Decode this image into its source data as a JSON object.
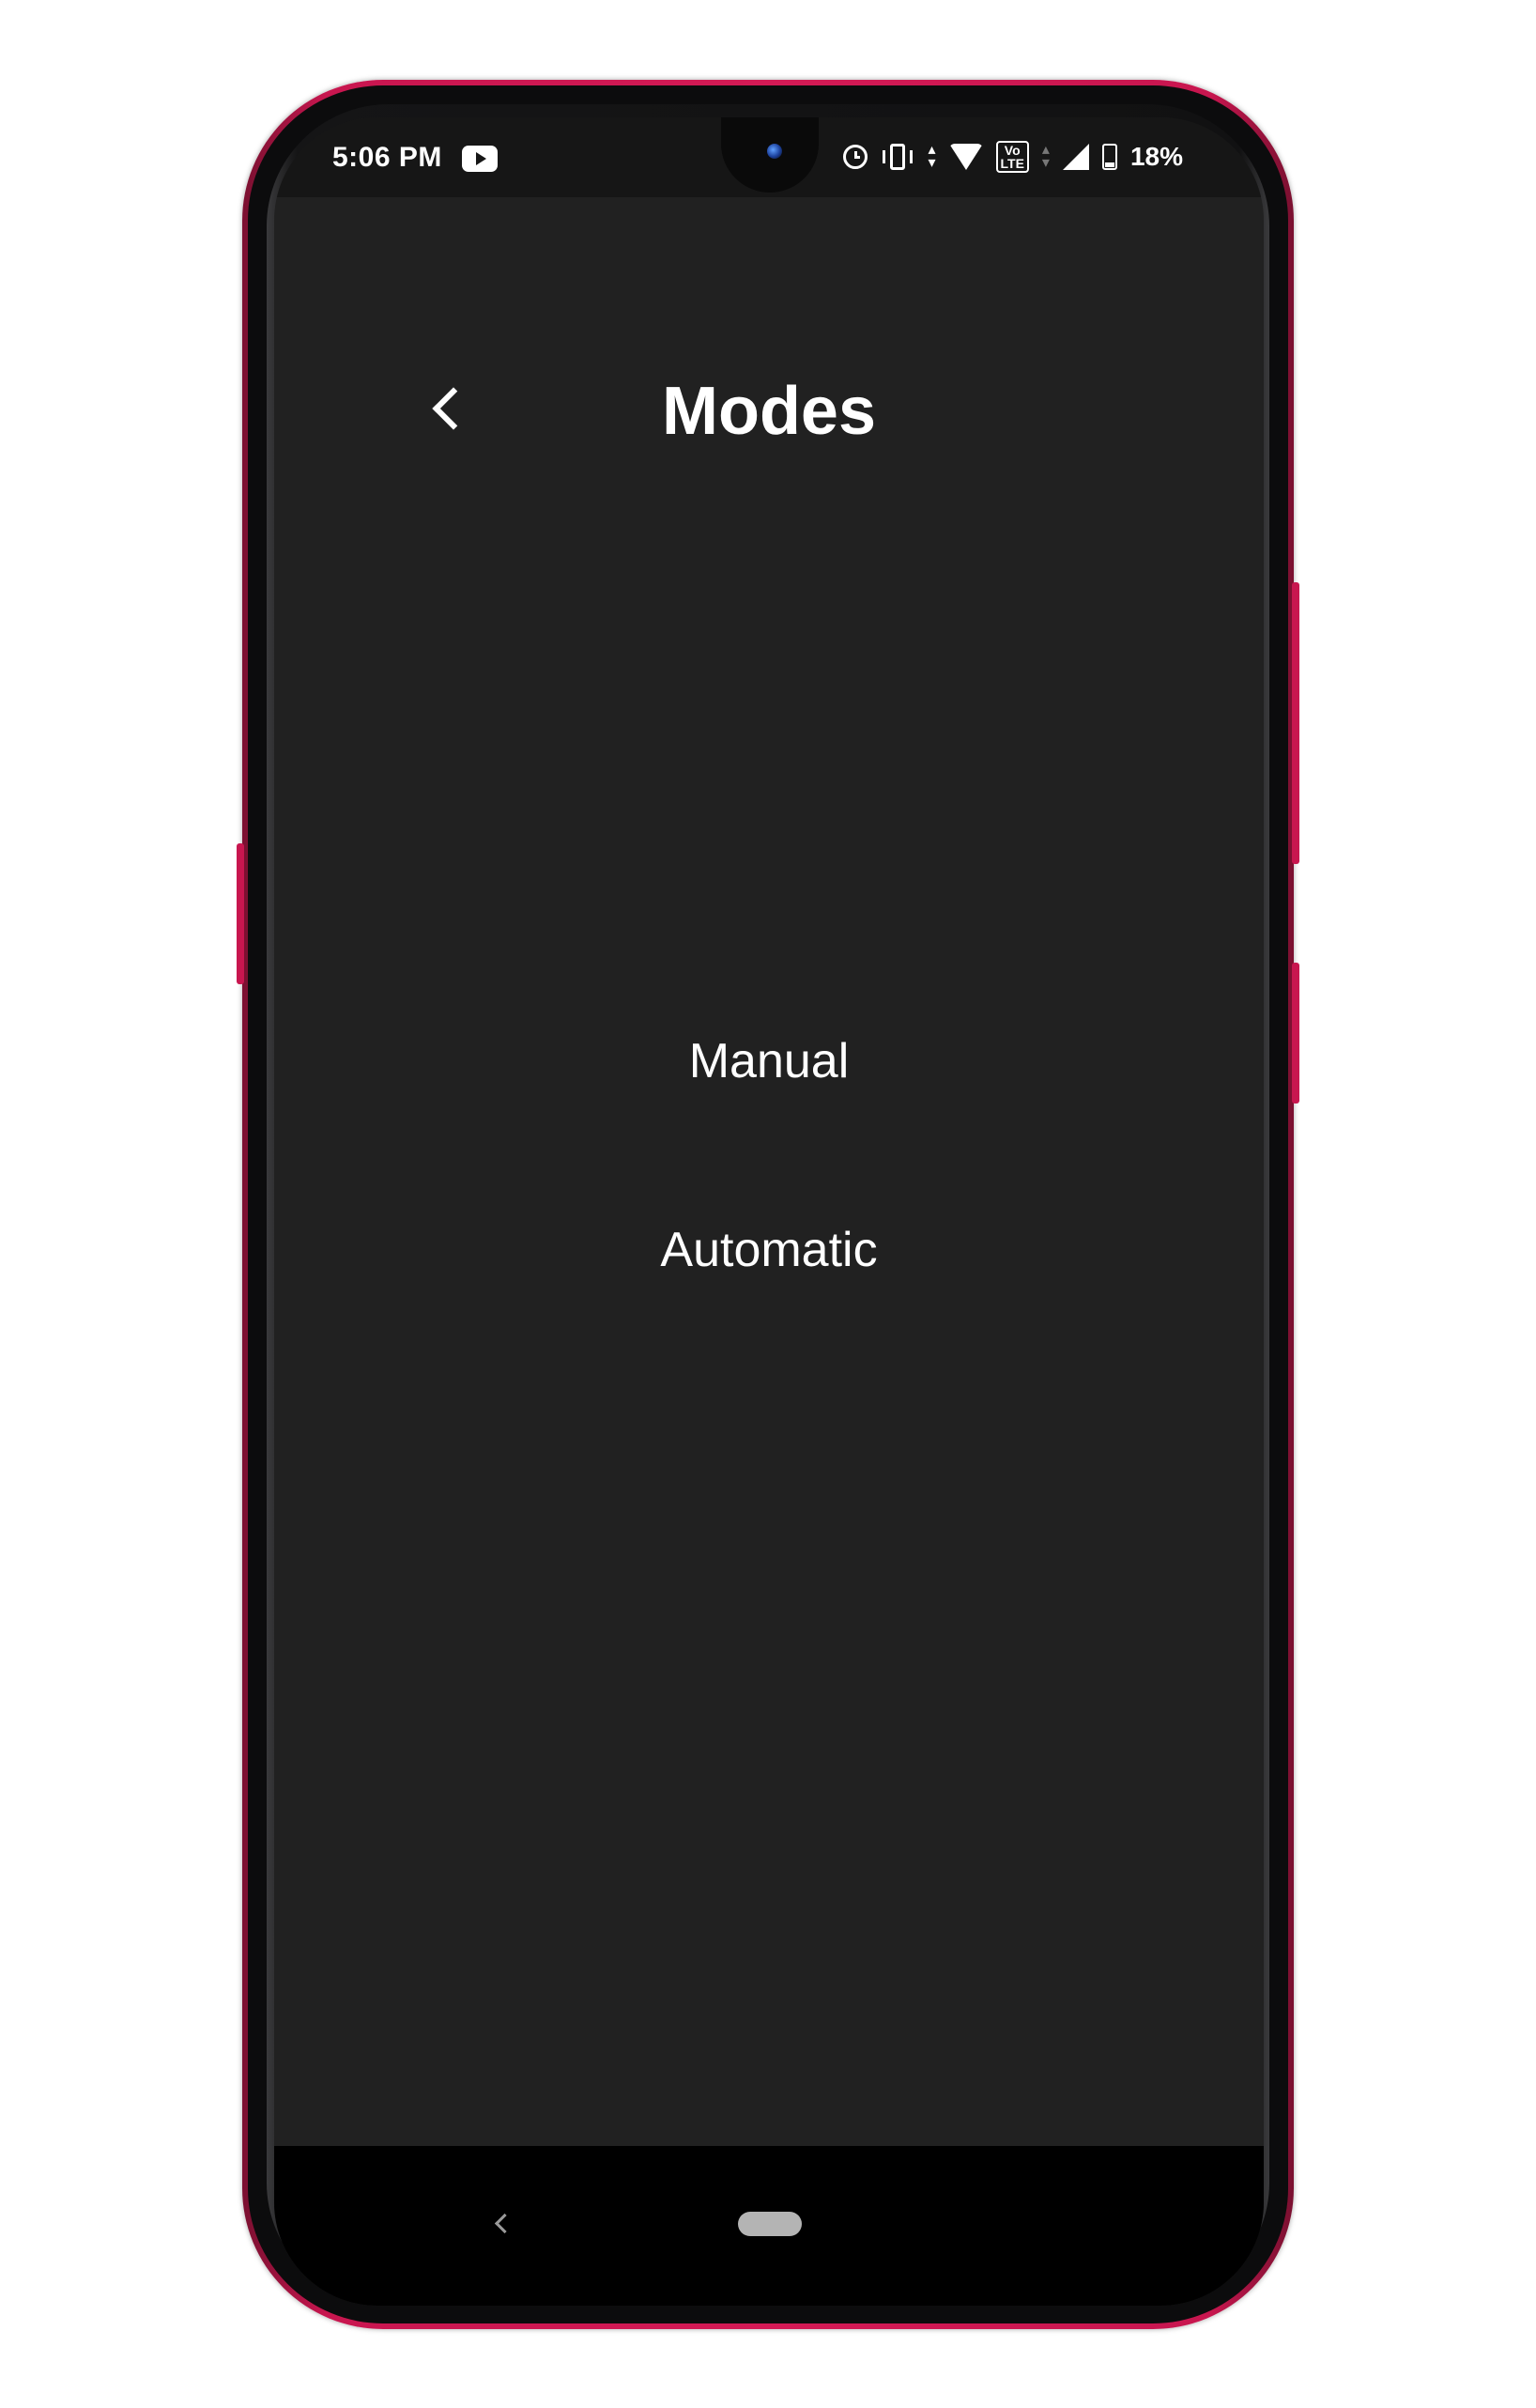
{
  "status_bar": {
    "time": "5:06 PM",
    "battery_percent": "18%",
    "icons": [
      "youtube-icon",
      "alarm-icon",
      "vibrate-icon",
      "data-arrows-icon",
      "wifi-icon",
      "volte-icon",
      "signal-icon",
      "battery-icon"
    ]
  },
  "header": {
    "title": "Modes",
    "back_icon": "chevron-left-icon"
  },
  "modes": {
    "items": [
      {
        "label": "Manual"
      },
      {
        "label": "Automatic"
      }
    ]
  },
  "nav_bar": {
    "back_icon": "chevron-left-icon",
    "home_icon": "home-pill-icon"
  },
  "colors": {
    "phone_frame": "#d41a55",
    "screen_background": "#212121",
    "text": "#ffffff"
  }
}
